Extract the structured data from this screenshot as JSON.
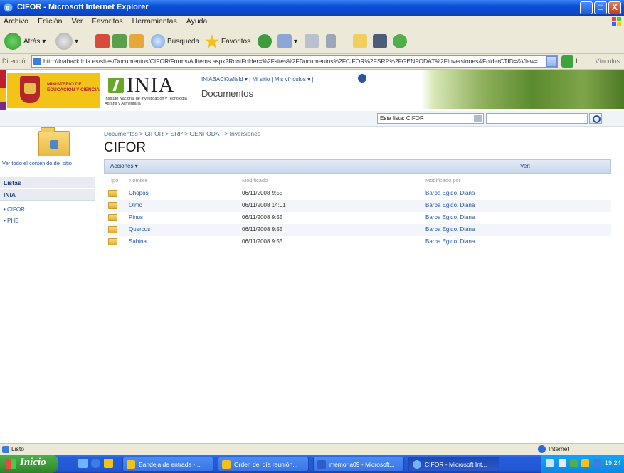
{
  "window": {
    "title": "CIFOR - Microsoft Internet Explorer",
    "minimize": "_",
    "maximize": "□",
    "close": "X"
  },
  "menu": [
    "Archivo",
    "Edición",
    "Ver",
    "Favoritos",
    "Herramientas",
    "Ayuda"
  ],
  "toolbar": {
    "back": "Atrás",
    "search": "Búsqueda",
    "favorites": "Favoritos"
  },
  "address": {
    "label": "Dirección",
    "url": "http://inaback.inia.es/sites/Documentos/CIFOR/Forms/AllItems.aspx?RootFolder=%2Fsites%2FDocumentos%2FCIFOR%2FSRP%2FGENFODAT%2FInversiones&FolderCTID=&View=",
    "go": "Ir",
    "links": "Vínculos"
  },
  "site": {
    "ministry": "MINISTERIO DE EDUCACIÓN Y CIENCIA",
    "logo_text": "INIA",
    "logo_sub": "Instituto Nacional de Investigación y Tecnología Agraria y Alimentaria",
    "user_links": "INIABACK\\afield ▾ | Mi sitio | Mis vínculos ▾ |",
    "site_title": "Documentos"
  },
  "search": {
    "scope": "Esta lista: CIFOR",
    "placeholder": ""
  },
  "nav": {
    "view_all": "Ver todo el contenido del sitio",
    "lists_header": "Listas",
    "inia_header": "INIA",
    "items": [
      "• CIFOR",
      "• PHE"
    ]
  },
  "content": {
    "breadcrumb": "Documentos > CIFOR > SRP > GENFODAT > Inversiones",
    "title": "CIFOR",
    "actions": "Acciones ▾",
    "view": "Ver:",
    "columns": {
      "type": "Tipo",
      "name": "Nombre",
      "modified": "Modificado",
      "modified_by": "Modificado por"
    },
    "rows": [
      {
        "name": "Chopos",
        "modified": "06/11/2008 9:55",
        "by": "Barba Egido, Diana"
      },
      {
        "name": "Olmo",
        "modified": "06/11/2008 14:01",
        "by": "Barba Egido, Diana"
      },
      {
        "name": "Pinus",
        "modified": "06/11/2008 9:55",
        "by": "Barba Egido, Diana"
      },
      {
        "name": "Quercus",
        "modified": "06/11/2008 9:55",
        "by": "Barba Egido, Diana"
      },
      {
        "name": "Sabina",
        "modified": "06/11/2008 9:55",
        "by": "Barba Egido, Diana"
      }
    ]
  },
  "status": {
    "text": "Listo",
    "zone": "Internet"
  },
  "taskbar": {
    "start": "Inicio",
    "tasks": [
      "Bandeja de entrada - ...",
      "Orden del día reunión...",
      "memoria09 - Microsoft...",
      "CIFOR - Microsoft Int..."
    ],
    "clock": "19:24"
  },
  "colors": {
    "titlebar": "#0a4fd6",
    "link": "#2857a1",
    "start_green": "#3a9a36",
    "xp_chrome": "#ece9d8"
  }
}
